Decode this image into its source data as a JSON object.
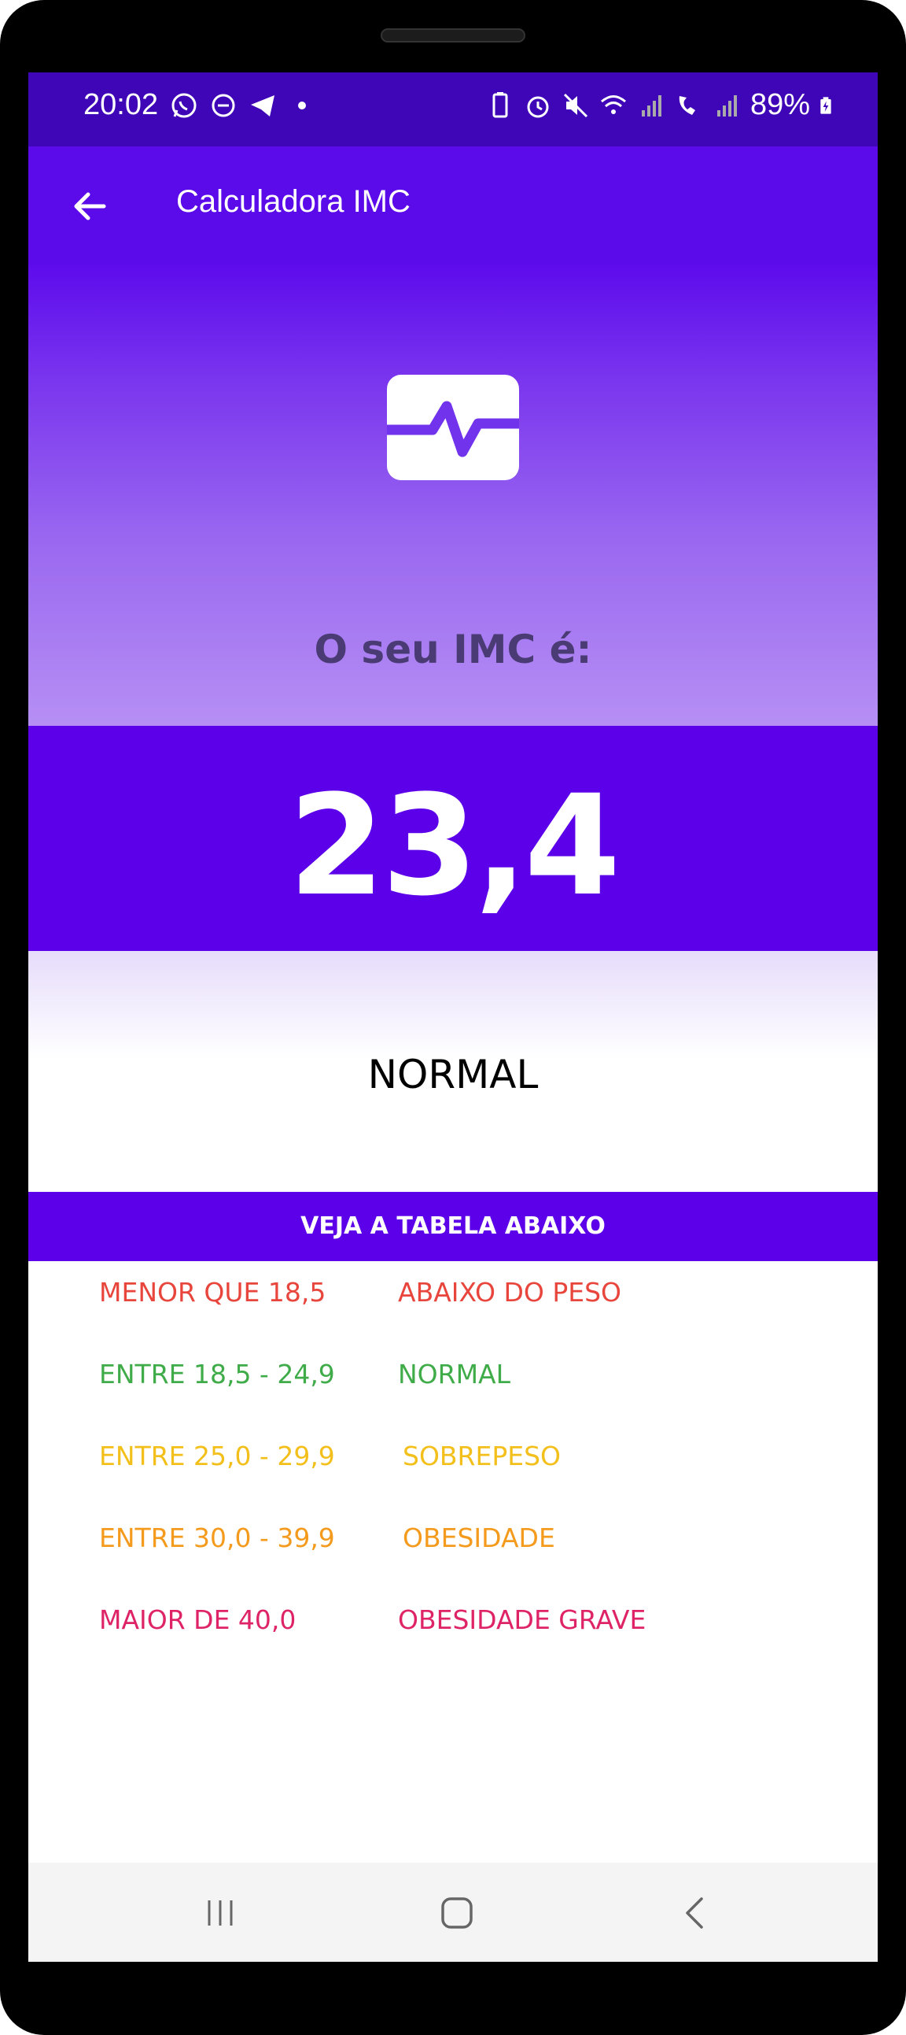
{
  "status_bar": {
    "time": "20:02",
    "battery": "89%",
    "left_icons": [
      "whatsapp-icon",
      "do-not-disturb-icon",
      "telegram-icon",
      "dot-icon"
    ],
    "right_icons": [
      "battery-saver-icon",
      "alarm-icon",
      "mute-icon",
      "wifi-icon",
      "signal-icon",
      "wifi-calling-icon",
      "signal-icon",
      "battery-charging-icon"
    ]
  },
  "app_bar": {
    "title": "Calculadora IMC",
    "back_icon": "arrow-back-icon"
  },
  "hero": {
    "icon": "pulse-monitor-icon",
    "result_label": "O seu IMC é:"
  },
  "result": {
    "value": "23,4",
    "classification": "NORMAL"
  },
  "table": {
    "header": "VEJA A TABELA ABAIXO",
    "rows": [
      {
        "range": "MENOR QUE 18,5",
        "category": "ABAIXO DO PESO",
        "color": "#e8453c"
      },
      {
        "range": "ENTRE 18,5 - 24,9",
        "category": "NORMAL",
        "color": "#3fac49"
      },
      {
        "range": "ENTRE 25,0 - 29,9",
        "category": "SOBREPESO",
        "color": "#f3bf1b"
      },
      {
        "range": "ENTRE 30,0 - 39,9",
        "category": "OBESIDADE",
        "color": "#f49a1c"
      },
      {
        "range": "MAIOR DE 40,0",
        "category": "OBESIDADE GRAVE",
        "color": "#de2366"
      }
    ]
  },
  "nav_bar": {
    "buttons": [
      "recent-apps-icon",
      "home-icon",
      "back-icon"
    ]
  },
  "colors": {
    "primary": "#5c00ea",
    "status_bar": "#3e06b7"
  }
}
